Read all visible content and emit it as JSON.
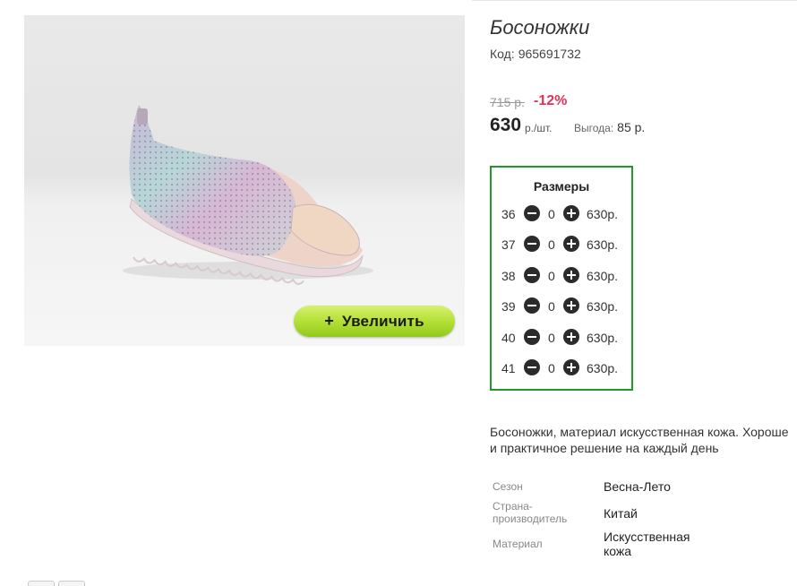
{
  "product": {
    "title": "Босоножки",
    "code_label": "Код:",
    "code_value": "965691732",
    "old_price": "715 р.",
    "discount": "-12%",
    "price": "630",
    "price_unit": "р./шт.",
    "savings_label": "Выгода:",
    "savings_value": "85 р.",
    "zoom_button": "Увеличить",
    "zoom_icon": "plus-icon"
  },
  "sizes": {
    "title": "Размеры",
    "rows": [
      {
        "size": "36",
        "qty": "0",
        "price": "630р."
      },
      {
        "size": "37",
        "qty": "0",
        "price": "630р."
      },
      {
        "size": "38",
        "qty": "0",
        "price": "630р."
      },
      {
        "size": "39",
        "qty": "0",
        "price": "630р."
      },
      {
        "size": "40",
        "qty": "0",
        "price": "630р."
      },
      {
        "size": "41",
        "qty": "0",
        "price": "630р."
      }
    ]
  },
  "description": {
    "line1": "Босоножки, материал искусственная кожа. Хороше",
    "line2": "и практичное решение на каждый день"
  },
  "specs": [
    {
      "label": "Сезон",
      "value": "Весна-Лето"
    },
    {
      "label": "Страна-производитель",
      "label_line1": "Страна-",
      "label_line2": "производитель",
      "value": "Китай"
    },
    {
      "label": "Материал",
      "value": "Искусственная кожа",
      "value_line1": "Искусственная",
      "value_line2": "кожа"
    }
  ],
  "colors": {
    "accent_green": "#1f9a28",
    "discount_red": "#e0325a",
    "zoom_button_green": "#b4e036"
  }
}
